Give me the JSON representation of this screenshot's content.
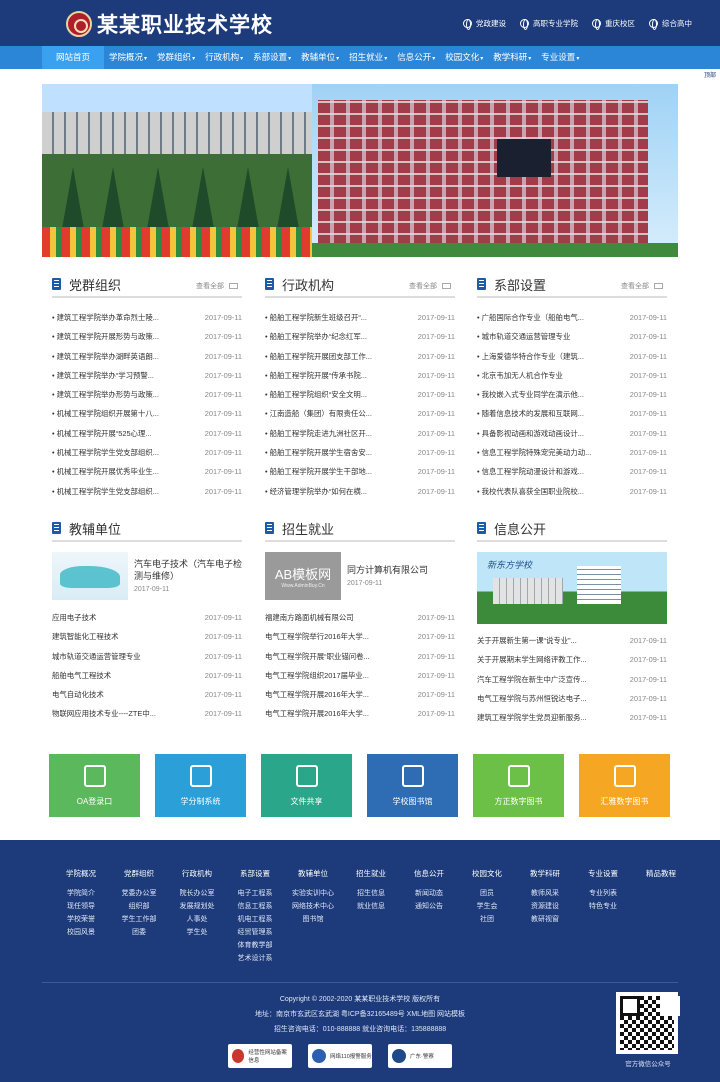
{
  "header": {
    "school_name": "某某职业技术学校",
    "quick_links": [
      "党政建设",
      "高职专业学院",
      "重庆校区",
      "综合高中"
    ]
  },
  "nav": {
    "items": [
      "网站首页",
      "学院概况",
      "党群组织",
      "行政机构",
      "系部设置",
      "教辅单位",
      "招生就业",
      "信息公开",
      "校园文化",
      "教学科研",
      "专业设置"
    ]
  },
  "top_link": "顶部",
  "sections": {
    "party": {
      "title": "党群组织",
      "more": "查看全部",
      "items": [
        {
          "title": "建筑工程学院举办革命烈士陵...",
          "date": "2017-09-11"
        },
        {
          "title": "建筑工程学院开展形势与政策...",
          "date": "2017-09-11"
        },
        {
          "title": "建筑工程学院举办湖畔英语朗...",
          "date": "2017-09-11"
        },
        {
          "title": "建筑工程学院举办“学习预警...",
          "date": "2017-09-11"
        },
        {
          "title": "建筑工程学院举办形势与政策...",
          "date": "2017-09-11"
        },
        {
          "title": "机械工程学院组织开展第十八...",
          "date": "2017-09-11"
        },
        {
          "title": "机械工程学院开展“525心理...",
          "date": "2017-09-11"
        },
        {
          "title": "机械工程学院学生党支部组织...",
          "date": "2017-09-11"
        },
        {
          "title": "机械工程学院开展优秀毕业生...",
          "date": "2017-09-11"
        },
        {
          "title": "机械工程学院学生党支部组织...",
          "date": "2017-09-11"
        }
      ]
    },
    "admin": {
      "title": "行政机构",
      "more": "查看全部",
      "items": [
        {
          "title": "船舶工程学院新生班级召开“...",
          "date": "2017-09-11"
        },
        {
          "title": "船舶工程学院举办“纪念红军...",
          "date": "2017-09-11"
        },
        {
          "title": "船舶工程学院开展团支部工作...",
          "date": "2017-09-11"
        },
        {
          "title": "船舶工程学院开展“传承书院...",
          "date": "2017-09-11"
        },
        {
          "title": "船舶工程学院组织“安全文明...",
          "date": "2017-09-11"
        },
        {
          "title": "江南造船（集团）有限责任公...",
          "date": "2017-09-11"
        },
        {
          "title": "船舶工程学院走进九洲社区开...",
          "date": "2017-09-11"
        },
        {
          "title": "船舶工程学院开展学生宿舍安...",
          "date": "2017-09-11"
        },
        {
          "title": "船舶工程学院开展学生干部地...",
          "date": "2017-09-11"
        },
        {
          "title": "经济管理学院举办“如何在横...",
          "date": "2017-09-11"
        }
      ]
    },
    "depts": {
      "title": "系部设置",
      "more": "查看全部",
      "items": [
        {
          "title": "广船国际合作专业（船舶电气...",
          "date": "2017-09-11"
        },
        {
          "title": "城市轨道交通运营管理专业",
          "date": "2017-09-11"
        },
        {
          "title": "上海爱德华特合作专业（建筑...",
          "date": "2017-09-11"
        },
        {
          "title": "北京韦加无人机合作专业",
          "date": "2017-09-11"
        },
        {
          "title": "我校嵌入式专业同学在演示他...",
          "date": "2017-09-11"
        },
        {
          "title": "随着信息技术的发展和互联网...",
          "date": "2017-09-11"
        },
        {
          "title": "具备影视动画和游戏动画设计...",
          "date": "2017-09-11"
        },
        {
          "title": "信息工程学院特殊宠完美动力动...",
          "date": "2017-09-11"
        },
        {
          "title": "信息工程学院动漫设计和游戏...",
          "date": "2017-09-11"
        },
        {
          "title": "我校代表队喜获全国职业院校...",
          "date": "2017-09-11"
        }
      ]
    },
    "aux": {
      "title": "教辅单位",
      "feature": {
        "title": "汽车电子技术（汽车电子检测与维修）",
        "date": "2017-09-11"
      },
      "items": [
        {
          "title": "应用电子技术",
          "date": "2017-09-11"
        },
        {
          "title": "建筑智能化工程技术",
          "date": "2017-09-11"
        },
        {
          "title": "城市轨道交通运营管理专业",
          "date": "2017-09-11"
        },
        {
          "title": "船舶电气工程技术",
          "date": "2017-09-11"
        },
        {
          "title": "电气自动化技术",
          "date": "2017-09-11"
        },
        {
          "title": "物联网应用技术专业----ZTE中...",
          "date": "2017-09-11"
        }
      ]
    },
    "jobs": {
      "title": "招生就业",
      "feature": {
        "title": "同方计算机有限公司",
        "date": "2017-09-11",
        "img_text": "AB模板网",
        "img_sub": "Www.AdminBuy.Cn"
      },
      "items": [
        {
          "title": "福建南方路面机械有限公司",
          "date": "2017-09-11"
        },
        {
          "title": "电气工程学院举行2016年大学...",
          "date": "2017-09-11"
        },
        {
          "title": "电气工程学院开展“职业锚问卷...",
          "date": "2017-09-11"
        },
        {
          "title": "电气工程学院组织2017届毕业...",
          "date": "2017-09-11"
        },
        {
          "title": "电气工程学院开展2016年大学...",
          "date": "2017-09-11"
        },
        {
          "title": "电气工程学院开展2016年大学...",
          "date": "2017-09-11"
        }
      ]
    },
    "info": {
      "title": "信息公开",
      "img_caption": "新东方学校",
      "items": [
        {
          "title": "关于开展新生第一课“说专业”...",
          "date": "2017-09-11"
        },
        {
          "title": "关于开展期末学生网络评教工作...",
          "date": "2017-09-11"
        },
        {
          "title": "汽车工程学院在新生中广泛宣传...",
          "date": "2017-09-11"
        },
        {
          "title": "电气工程学院与苏州恒锐达电子...",
          "date": "2017-09-11"
        },
        {
          "title": "建筑工程学院学生党员迎新服务...",
          "date": "2017-09-11"
        }
      ]
    }
  },
  "tiles": [
    {
      "label": "OA登录口",
      "color": "#5cb85c",
      "icon": "id-card-icon"
    },
    {
      "label": "学分制系统",
      "color": "#2a9fd8",
      "icon": "chart-monitor-icon"
    },
    {
      "label": "文件共享",
      "color": "#2aa78a",
      "icon": "document-share-icon"
    },
    {
      "label": "学校图书馆",
      "color": "#2e6db4",
      "icon": "bookshelf-icon"
    },
    {
      "label": "方正数字图书",
      "color": "#6cbf47",
      "icon": "book-icon"
    },
    {
      "label": "汇雅数字图书",
      "color": "#f5a623",
      "icon": "books-icon"
    }
  ],
  "footer": {
    "columns": [
      {
        "head": "学院概况",
        "items": [
          "学院简介",
          "现任领导",
          "学校荣誉",
          "校园风景"
        ]
      },
      {
        "head": "党群组织",
        "items": [
          "党委办公室",
          "组织部",
          "学生工作部",
          "团委"
        ]
      },
      {
        "head": "行政机构",
        "items": [
          "院长办公室",
          "发展规划处",
          "人事处",
          "学生处"
        ]
      },
      {
        "head": "系部设置",
        "items": [
          "电子工程系",
          "信息工程系",
          "机电工程系",
          "经贸管理系",
          "体育教学部",
          "艺术设计系"
        ]
      },
      {
        "head": "教辅单位",
        "items": [
          "实验实训中心",
          "网络技术中心",
          "图书馆"
        ]
      },
      {
        "head": "招生就业",
        "items": [
          "招生信息",
          "就业信息"
        ]
      },
      {
        "head": "信息公开",
        "items": [
          "新闻动态",
          "通知公告"
        ]
      },
      {
        "head": "校园文化",
        "items": [
          "团员",
          "学生会",
          "社团"
        ]
      },
      {
        "head": "教学科研",
        "items": [
          "教师风采",
          "资源建设",
          "教研视窗"
        ]
      },
      {
        "head": "专业设置",
        "items": [
          "专业列表",
          "特色专业"
        ]
      },
      {
        "head": "精品教程",
        "items": []
      }
    ],
    "copyright": "Copyright © 2002-2020 某某职业技术学校 版权所有",
    "address": "地址：南京市玄武区玄武湖 粤ICP备32165489号 XML地图 网站模板",
    "phone": "招生咨询电话：010-888888 就业咨询电话：135888888",
    "badges": [
      "经营性网站备案信息",
      "网络110报警服务",
      "广东·警察"
    ],
    "qr_caption": "官方微信公众号"
  }
}
